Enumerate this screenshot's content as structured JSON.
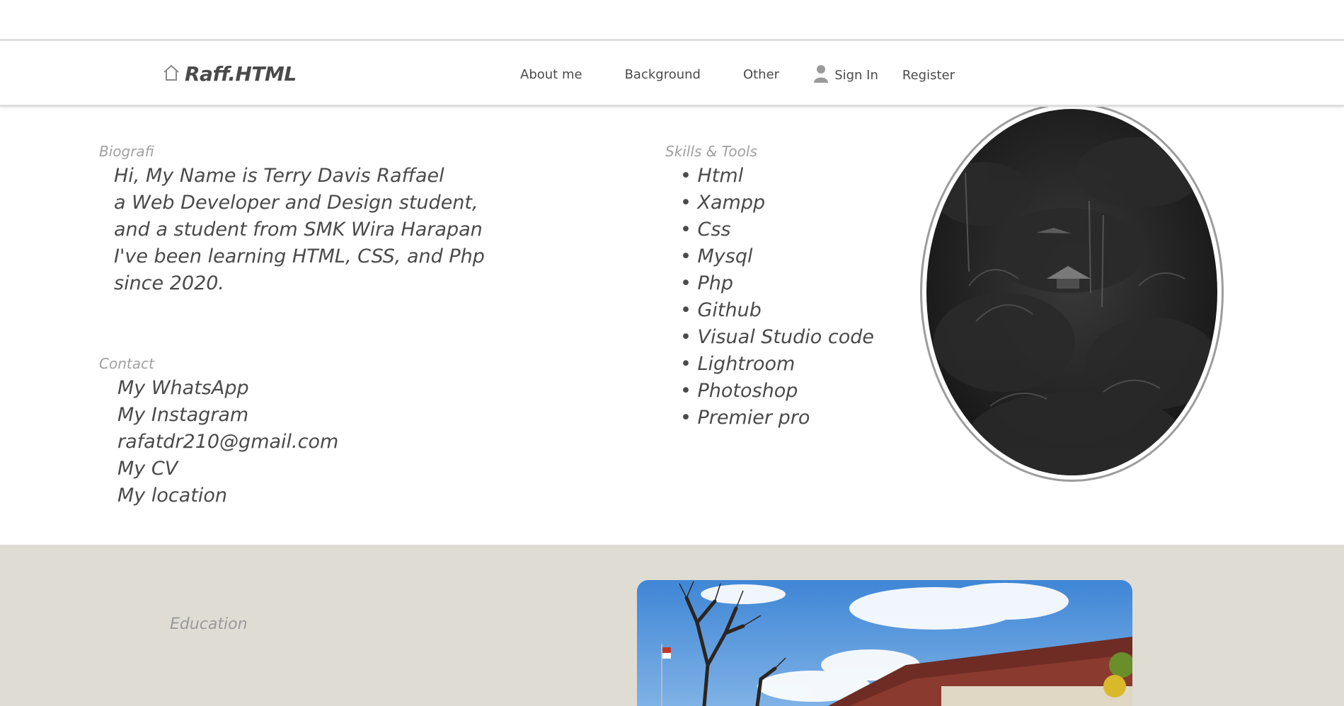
{
  "brand": {
    "name": "Raff.HTML",
    "icon": "home-icon"
  },
  "nav": {
    "links": [
      "About me",
      "Background",
      "Other"
    ]
  },
  "auth": {
    "sign_in": "Sign In",
    "register": "Register",
    "user_icon": "user-icon"
  },
  "biografi": {
    "label": "Biografi",
    "lines": [
      "Hi, My Name is Terry Davis Raffael",
      "a Web Developer and Design student,",
      "and a student from SMK Wira Harapan",
      "I've been learning HTML, CSS, and Php",
      "since 2020."
    ]
  },
  "contact": {
    "label": "Contact",
    "items": [
      "My WhatsApp",
      "My Instagram",
      "rafatdr210@gmail.com",
      "My CV",
      "My location"
    ]
  },
  "skills": {
    "label": "Skills & Tools",
    "items": [
      "• Html",
      "• Xampp",
      "• Css",
      "• Mysql",
      "• Php",
      "• Github",
      "• Visual Studio code",
      "• Lightroom",
      "• Photoshop",
      "• Premier pro"
    ]
  },
  "education": {
    "label": "Education"
  },
  "colors": {
    "text": "#4a4a4a",
    "muted_label": "#a0a0a0",
    "lower_bg": "#dfdcd4",
    "nav_border": "#dedede"
  }
}
